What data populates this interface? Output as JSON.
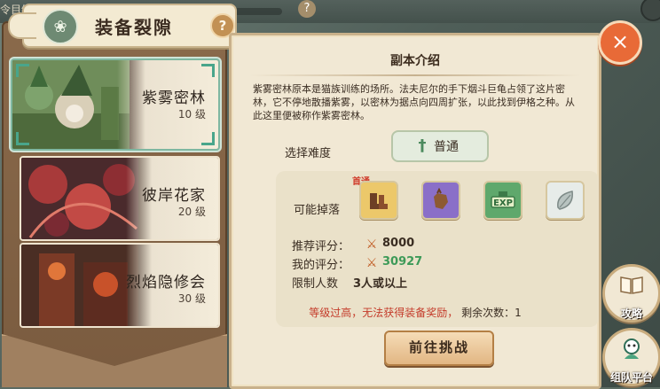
{
  "background": {
    "top_hint": "令目经",
    "help_glyph": "?"
  },
  "header": {
    "title": "装备裂隙",
    "help": "?",
    "icon": "flower-emblem-icon"
  },
  "dungeons": [
    {
      "name": "紫雾密林",
      "level": "10 级",
      "selected": true
    },
    {
      "name": "彼岸花家",
      "level": "20 级",
      "selected": false
    },
    {
      "name": "烈焰隐修会",
      "level": "30 级",
      "selected": false
    }
  ],
  "panel": {
    "title": "副本介绍",
    "description": "紫雾密林原本是猫族训练的场所。法夫尼尔的手下烟斗巨龟占领了这片密林，它不停地散播紫雾，以密林为据点向四周扩张，以此找到伊格之种。从此这里便被称作紫雾密林。",
    "difficulty_label": "选择难度",
    "difficulty_value": "普通",
    "drops_label": "可能掉落",
    "first_clear_badge": "首通",
    "drops": [
      "boots-icon",
      "gloves-icon",
      "exp-icon",
      "leaf-icon"
    ],
    "recommended_label": "推荐评分：",
    "recommended_value": "8000",
    "my_score_label": "我的评分：",
    "my_score_value": "30927",
    "party_label": "限制人数",
    "party_value": "3人或以上",
    "warning_red": "等级过高，无法获得装备奖励，",
    "warning_dark": "剩余次数：1",
    "challenge_button": "前往挑战"
  },
  "close_button": "×",
  "side_buttons": [
    {
      "label": "攻略",
      "icon": "book-icon"
    },
    {
      "label": "组队平台",
      "icon": "team-icon"
    }
  ],
  "colors": {
    "accent_green": "#49a58b",
    "score_green": "#3d9a58",
    "warning_red": "#c43b2a",
    "close_orange": "#e86a37"
  }
}
